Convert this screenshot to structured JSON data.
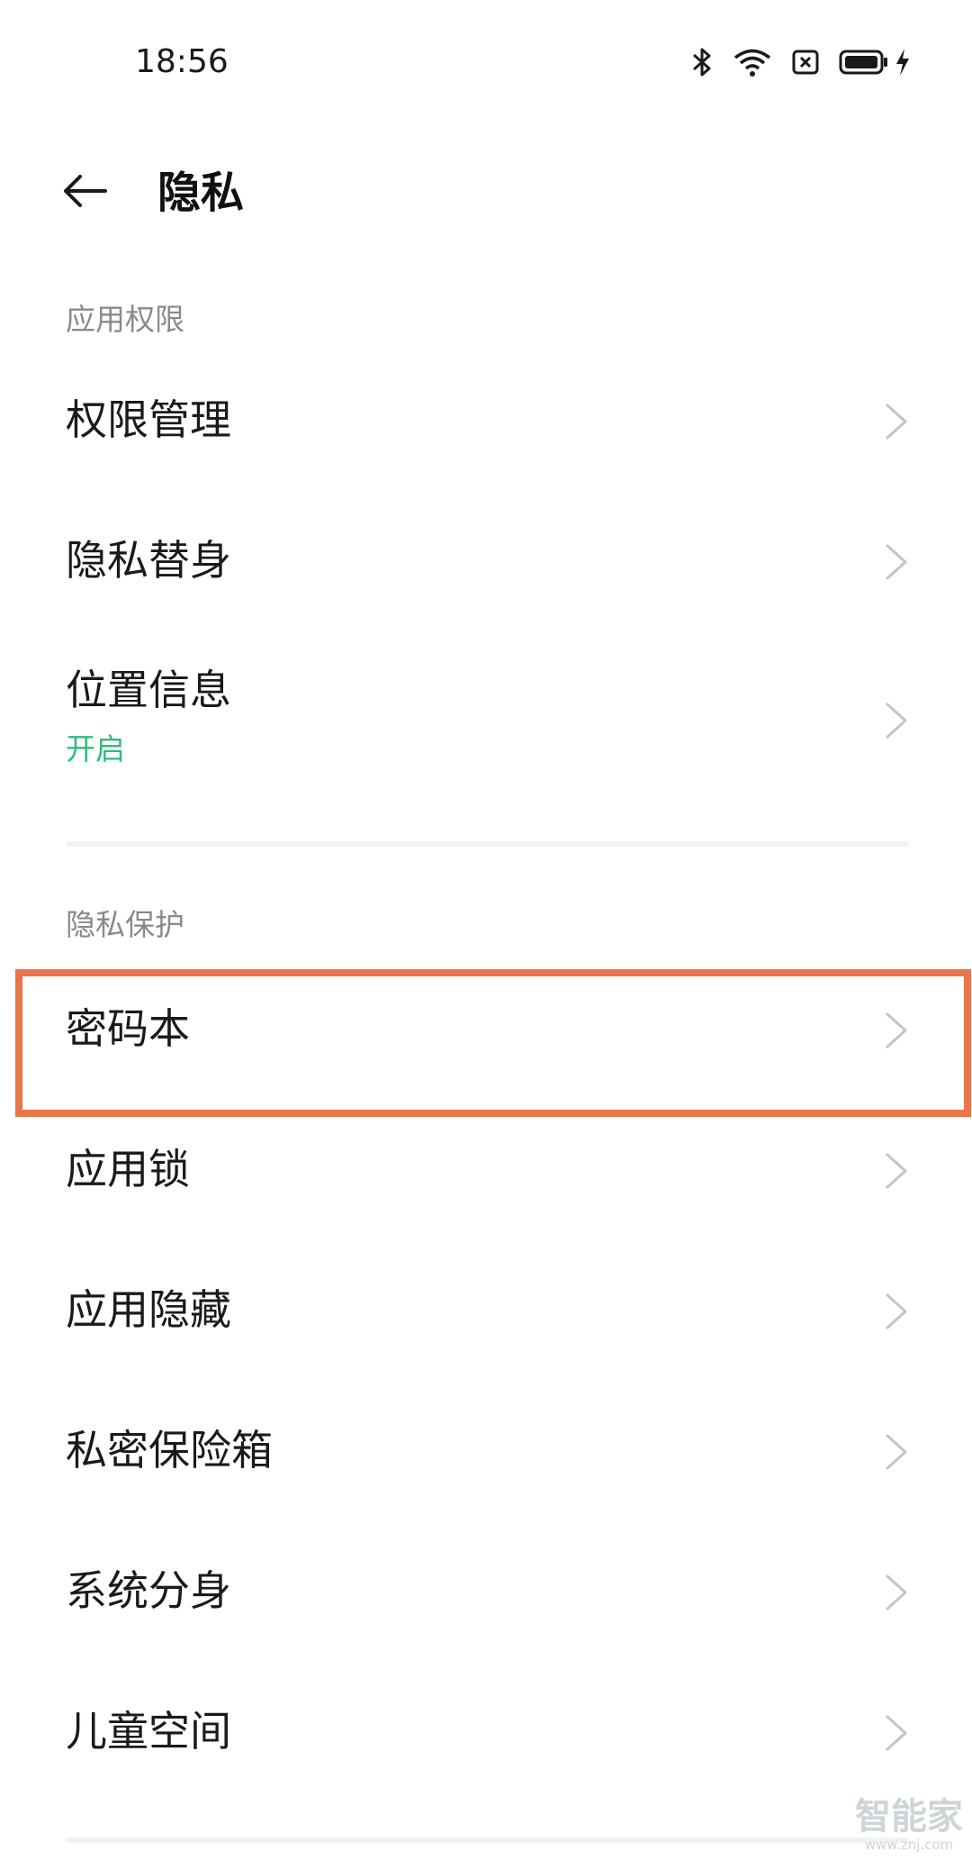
{
  "status_bar": {
    "time": "18:56",
    "icons": [
      "bluetooth-icon",
      "wifi-icon",
      "sim-blocked-icon",
      "battery-icon",
      "charging-icon"
    ]
  },
  "header": {
    "back_icon": "arrow-left-icon",
    "title": "隐私"
  },
  "sections": [
    {
      "title": "应用权限",
      "items": [
        {
          "label": "权限管理"
        },
        {
          "label": "隐私替身"
        },
        {
          "label": "位置信息",
          "sub": "开启"
        }
      ]
    },
    {
      "title": "隐私保护",
      "items": [
        {
          "label": "密码本"
        },
        {
          "label": "应用锁"
        },
        {
          "label": "应用隐藏"
        },
        {
          "label": "私密保险箱"
        },
        {
          "label": "系统分身"
        },
        {
          "label": "儿童空间"
        }
      ]
    }
  ],
  "colors": {
    "accent_green": "#2dbd7e",
    "highlight_orange": "#e9754a"
  },
  "watermark": {
    "main": "智能家",
    "sub": "www.znj.com"
  }
}
